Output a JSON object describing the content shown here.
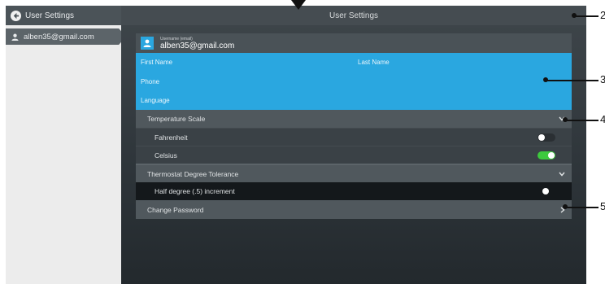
{
  "sidebar": {
    "header_label": "User Settings",
    "user_label": "alben35@gmail.com"
  },
  "top_bar": {
    "title": "User Settings"
  },
  "user_card": {
    "username_label": "Username (email)",
    "username_value": "alben35@gmail.com"
  },
  "profile_fields": {
    "first_name": "First Name",
    "last_name": "Last Name",
    "phone": "Phone",
    "language": "Language"
  },
  "temperature": {
    "label": "Temperature Scale",
    "options": [
      {
        "label": "Fahrenheit",
        "on": false
      },
      {
        "label": "Celsius",
        "on": true
      }
    ]
  },
  "tolerance": {
    "label": "Thermostat Degree Tolerance",
    "option_label": "Half degree (.5) increment"
  },
  "change_password": {
    "label": "Change Password"
  },
  "callouts": [
    "2",
    "3",
    "4",
    "5"
  ],
  "colors": {
    "accent": "#2aa7e0",
    "toggle_on": "#3dc93d"
  }
}
